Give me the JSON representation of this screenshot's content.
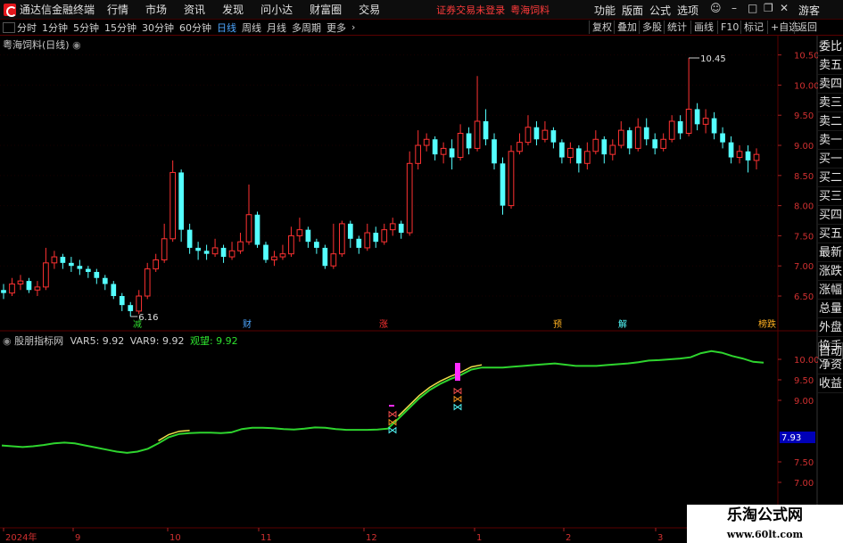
{
  "menubar": {
    "app_title": "通达信金融终端",
    "items": [
      "行情",
      "市场",
      "资讯",
      "发现",
      "问小达",
      "财富圈",
      "交易"
    ],
    "status": "证券交易未登录",
    "stock": "粤海饲料",
    "right_items": [
      "功能",
      "版面",
      "公式",
      "选项"
    ],
    "guest": "游客"
  },
  "toolbar": {
    "periods": [
      "分时",
      "1分钟",
      "5分钟",
      "15分钟",
      "30分钟",
      "60分钟",
      "日线",
      "周线",
      "月线",
      "多周期",
      "更多"
    ],
    "active_period": "日线",
    "right_buttons": [
      "复权",
      "叠加",
      "多股",
      "统计",
      "画线",
      "F10",
      "标记",
      "+自选",
      "返回"
    ]
  },
  "main_chart": {
    "title": "粤海饲料(日线)",
    "high_label": "10.45",
    "low_label": "6.16",
    "y_ticks": [
      "10.50",
      "10.00",
      "9.50",
      "9.00",
      "8.50",
      "8.00",
      "7.50",
      "7.00",
      "6.50"
    ],
    "markers": [
      "减",
      "财",
      "涨",
      "预",
      "解",
      "榜跌"
    ]
  },
  "indicator": {
    "name": "股朋指标网",
    "var5": "VAR5: 9.92",
    "var9": "VAR9: 9.92",
    "watch": "观望: 9.92",
    "y_ticks": [
      "10.00",
      "9.50",
      "9.00",
      "7.50",
      "7.00"
    ],
    "current_value": "7.93"
  },
  "x_axis": [
    "2024年",
    "9",
    "10",
    "11",
    "12",
    "1",
    "2",
    "3"
  ],
  "right_column": [
    "委比",
    "卖五",
    "卖四",
    "卖三",
    "卖二",
    "卖一",
    "买一",
    "买二",
    "买三",
    "买四",
    "买五",
    "最新",
    "涨跌",
    "涨幅",
    "总量",
    "外盘",
    "换手",
    "净资",
    "收益"
  ],
  "auto_button": "自动",
  "watermark": {
    "line1": "乐淘公式网",
    "line2": "www.60lt.com"
  },
  "colors": {
    "up": "#ff3232",
    "down": "#54ffff",
    "indicator_line": "#2ed42e",
    "indicator_yellow": "#f0e04a",
    "magenta": "#ff2cff",
    "grid": "#5a0000",
    "background": "#000000"
  },
  "chart_data": {
    "type": "candlestick",
    "title": "粤海饲料(日线)",
    "x_labels": [
      "2024年",
      "9",
      "10",
      "11",
      "12",
      "1",
      "2",
      "3"
    ],
    "ylim": [
      6.16,
      10.6
    ],
    "high": 10.45,
    "low": 6.16,
    "candles": [
      [
        6.6,
        6.55,
        6.7,
        6.45
      ],
      [
        6.55,
        6.7,
        6.8,
        6.5
      ],
      [
        6.7,
        6.75,
        6.85,
        6.6
      ],
      [
        6.75,
        6.6,
        6.8,
        6.55
      ],
      [
        6.6,
        6.65,
        6.75,
        6.5
      ],
      [
        6.65,
        7.05,
        7.3,
        6.6
      ],
      [
        7.05,
        7.15,
        7.25,
        6.95
      ],
      [
        7.15,
        7.05,
        7.2,
        6.95
      ],
      [
        7.05,
        7.0,
        7.15,
        6.9
      ],
      [
        7.0,
        6.95,
        7.1,
        6.85
      ],
      [
        6.95,
        6.9,
        7.0,
        6.8
      ],
      [
        6.9,
        6.8,
        6.95,
        6.7
      ],
      [
        6.8,
        6.7,
        6.85,
        6.6
      ],
      [
        6.7,
        6.5,
        6.75,
        6.45
      ],
      [
        6.5,
        6.35,
        6.55,
        6.25
      ],
      [
        6.35,
        6.25,
        6.4,
        6.16
      ],
      [
        6.25,
        6.5,
        6.6,
        6.2
      ],
      [
        6.5,
        6.95,
        7.05,
        6.45
      ],
      [
        6.95,
        7.1,
        7.2,
        6.9
      ],
      [
        7.1,
        7.45,
        7.7,
        7.05
      ],
      [
        7.45,
        8.55,
        8.75,
        7.4
      ],
      [
        8.55,
        7.6,
        8.6,
        7.4
      ],
      [
        7.6,
        7.3,
        7.7,
        7.2
      ],
      [
        7.3,
        7.25,
        7.4,
        7.1
      ],
      [
        7.25,
        7.2,
        7.35,
        7.1
      ],
      [
        7.2,
        7.3,
        7.45,
        7.15
      ],
      [
        7.3,
        7.15,
        7.35,
        7.05
      ],
      [
        7.15,
        7.25,
        7.4,
        7.1
      ],
      [
        7.25,
        7.4,
        7.55,
        7.2
      ],
      [
        7.4,
        7.85,
        8.35,
        7.35
      ],
      [
        7.85,
        7.35,
        7.9,
        7.3
      ],
      [
        7.35,
        7.1,
        7.4,
        7.05
      ],
      [
        7.1,
        7.15,
        7.25,
        7.0
      ],
      [
        7.15,
        7.2,
        7.35,
        7.1
      ],
      [
        7.2,
        7.5,
        7.65,
        7.15
      ],
      [
        7.5,
        7.6,
        7.8,
        7.4
      ],
      [
        7.6,
        7.4,
        7.65,
        7.3
      ],
      [
        7.4,
        7.3,
        7.45,
        7.2
      ],
      [
        7.3,
        7.0,
        7.35,
        6.95
      ],
      [
        7.0,
        7.2,
        7.7,
        6.95
      ],
      [
        7.2,
        7.7,
        7.75,
        7.15
      ],
      [
        7.7,
        7.45,
        7.75,
        7.3
      ],
      [
        7.45,
        7.3,
        7.5,
        7.2
      ],
      [
        7.3,
        7.55,
        7.7,
        7.25
      ],
      [
        7.55,
        7.4,
        7.65,
        7.3
      ],
      [
        7.4,
        7.6,
        7.7,
        7.35
      ],
      [
        7.6,
        7.7,
        7.8,
        7.5
      ],
      [
        7.7,
        7.55,
        7.75,
        7.45
      ],
      [
        7.55,
        8.7,
        8.9,
        7.5
      ],
      [
        8.7,
        9.0,
        9.25,
        8.6
      ],
      [
        9.0,
        9.1,
        9.2,
        8.9
      ],
      [
        9.1,
        8.85,
        9.15,
        8.75
      ],
      [
        8.85,
        8.95,
        9.05,
        8.7
      ],
      [
        8.95,
        8.8,
        9.1,
        8.6
      ],
      [
        8.8,
        9.2,
        9.35,
        8.75
      ],
      [
        9.2,
        8.95,
        9.3,
        8.85
      ],
      [
        8.95,
        9.4,
        10.15,
        8.9
      ],
      [
        9.4,
        9.1,
        9.6,
        9.0
      ],
      [
        9.1,
        8.7,
        9.2,
        8.6
      ],
      [
        8.7,
        8.0,
        8.8,
        7.85
      ],
      [
        8.0,
        8.9,
        9.0,
        7.95
      ],
      [
        8.9,
        9.05,
        9.2,
        8.85
      ],
      [
        9.05,
        9.3,
        9.5,
        9.0
      ],
      [
        9.3,
        9.1,
        9.4,
        9.0
      ],
      [
        9.1,
        9.25,
        9.4,
        9.05
      ],
      [
        9.25,
        9.05,
        9.3,
        8.95
      ],
      [
        9.05,
        8.8,
        9.1,
        8.7
      ],
      [
        8.8,
        8.95,
        9.05,
        8.7
      ],
      [
        8.95,
        8.7,
        9.0,
        8.55
      ],
      [
        8.7,
        8.9,
        9.05,
        8.6
      ],
      [
        8.9,
        9.1,
        9.25,
        8.85
      ],
      [
        9.1,
        8.85,
        9.15,
        8.7
      ],
      [
        8.85,
        9.0,
        9.1,
        8.75
      ],
      [
        9.0,
        9.25,
        9.4,
        8.95
      ],
      [
        9.25,
        8.95,
        9.3,
        8.85
      ],
      [
        8.95,
        9.3,
        9.45,
        8.9
      ],
      [
        9.3,
        9.1,
        9.45,
        9.0
      ],
      [
        9.1,
        8.95,
        9.2,
        8.85
      ],
      [
        8.95,
        9.1,
        9.2,
        8.9
      ],
      [
        9.1,
        9.4,
        9.5,
        9.05
      ],
      [
        9.4,
        9.2,
        9.5,
        9.1
      ],
      [
        9.2,
        9.6,
        10.45,
        9.15
      ],
      [
        9.6,
        9.35,
        9.7,
        9.25
      ],
      [
        9.35,
        9.45,
        9.6,
        9.2
      ],
      [
        9.45,
        9.2,
        9.55,
        9.1
      ],
      [
        9.2,
        9.05,
        9.3,
        8.95
      ],
      [
        9.05,
        8.8,
        9.15,
        8.7
      ],
      [
        8.8,
        8.9,
        9.0,
        8.7
      ],
      [
        8.9,
        8.75,
        9.0,
        8.55
      ],
      [
        8.75,
        8.85,
        8.95,
        8.6
      ]
    ],
    "indicator": {
      "name": "股朋指标网",
      "ylim": [
        6.7,
        10.3
      ],
      "watch_line": [
        7.9,
        7.88,
        7.86,
        7.88,
        7.91,
        7.95,
        7.97,
        7.95,
        7.9,
        7.85,
        7.8,
        7.75,
        7.72,
        7.75,
        7.82,
        7.95,
        8.1,
        8.18,
        8.2,
        8.21,
        8.21,
        8.2,
        8.22,
        8.3,
        8.33,
        8.33,
        8.32,
        8.3,
        8.29,
        8.31,
        8.34,
        8.33,
        8.3,
        8.28,
        8.28,
        8.28,
        8.29,
        8.31,
        8.55,
        8.8,
        9.05,
        9.25,
        9.4,
        9.52,
        9.62,
        9.75,
        9.8,
        9.8,
        9.8,
        9.82,
        9.84,
        9.86,
        9.88,
        9.9,
        9.87,
        9.84,
        9.84,
        9.84,
        9.86,
        9.88,
        9.9,
        9.93,
        9.97,
        9.98,
        10.0,
        10.02,
        10.05,
        10.15,
        10.2,
        10.16,
        10.08,
        10.02,
        9.94,
        9.92
      ]
    }
  }
}
